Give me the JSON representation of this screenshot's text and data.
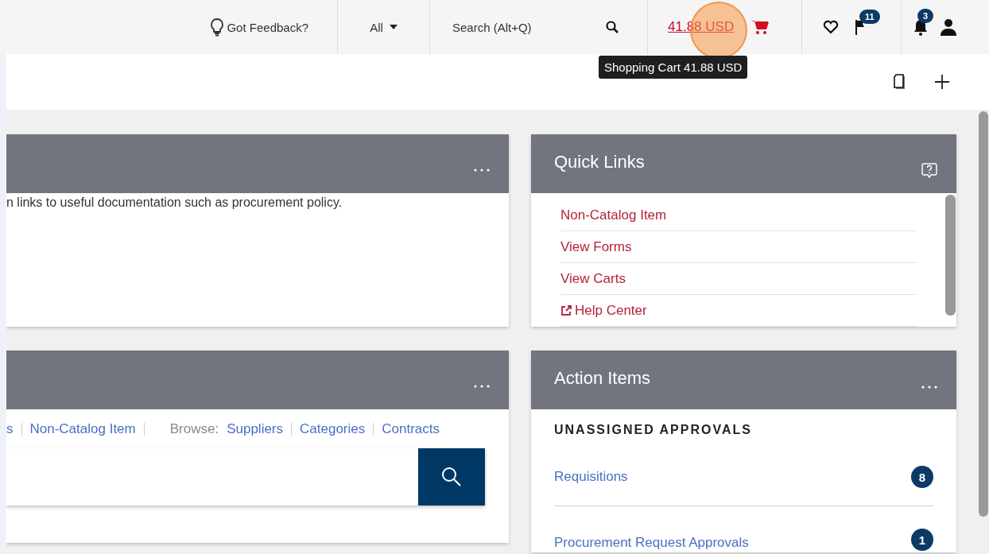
{
  "top_bar": {
    "feedback": "Got Feedback?",
    "search_scope": "All",
    "search_placeholder": "Search (Alt+Q)",
    "cart_total": "41.88 USD",
    "flag_count": "11",
    "notification_count": "3"
  },
  "tooltip": "Shopping Cart 41.88 USD",
  "left_panels": [
    {
      "kind": "text",
      "body_text": "n links to useful documentation such as procurement policy."
    },
    {
      "kind": "shop",
      "links": [
        "s",
        "Non-Catalog Item"
      ],
      "browse_label": "Browse:",
      "browse_links": [
        "Suppliers",
        "Categories",
        "Contracts"
      ]
    }
  ],
  "quick_links": {
    "title": "Quick Links",
    "links": [
      {
        "label": "Non-Catalog Item",
        "external": false
      },
      {
        "label": "View Forms",
        "external": false
      },
      {
        "label": "View Carts",
        "external": false
      },
      {
        "label": "Help Center",
        "external": true
      }
    ]
  },
  "action_items": {
    "title": "Action Items",
    "section": "UNASSIGNED APPROVALS",
    "items": [
      {
        "label": "Requisitions",
        "count": "8"
      },
      {
        "label": "Procurement Request Approvals",
        "count": "1"
      }
    ]
  }
}
